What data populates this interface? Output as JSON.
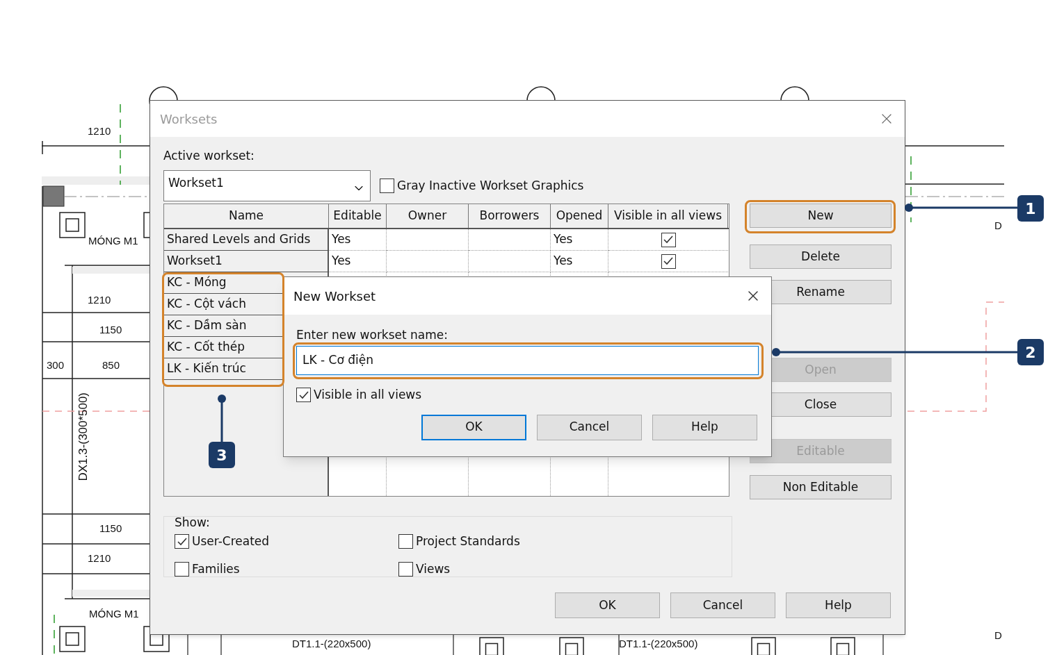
{
  "drawing": {
    "labels": [
      "1210",
      "MÓNG M1",
      "1210",
      "1150",
      "300",
      "850",
      "DX1.3-(300*500)",
      "1150",
      "1210",
      "MÓNG M1",
      "DT1.1-(220x500)",
      "DT1.1-(220x500)",
      "D",
      "D"
    ]
  },
  "dialog": {
    "title": "Worksets",
    "active_workset_label": "Active workset:",
    "active_workset": "Workset1",
    "gray_inactive": {
      "label": "Gray Inactive Workset Graphics",
      "checked": false
    },
    "table": {
      "columns": [
        "Name",
        "Editable",
        "Owner",
        "Borrowers",
        "Opened",
        "Visible in all views"
      ],
      "rows": [
        {
          "name": "Shared Levels and Grids",
          "editable": "Yes",
          "opened": "Yes",
          "visible": true
        },
        {
          "name": "Workset1",
          "editable": "Yes",
          "opened": "Yes",
          "visible": true
        },
        {
          "name": "KC - Móng"
        },
        {
          "name": "KC - Cột vách"
        },
        {
          "name": "KC - Dầm sàn"
        },
        {
          "name": "KC - Cốt thép"
        },
        {
          "name": "LK - Kiến trúc"
        }
      ]
    },
    "side_buttons": [
      {
        "label": "New",
        "disabled": false
      },
      {
        "label": "Delete",
        "disabled": false
      },
      {
        "label": "Rename",
        "disabled": false
      },
      {
        "label": "Open",
        "disabled": true
      },
      {
        "label": "Close",
        "disabled": false
      },
      {
        "label": "Editable",
        "disabled": true
      },
      {
        "label": "Non Editable",
        "disabled": false
      }
    ],
    "show": {
      "label": "Show:",
      "options": [
        {
          "label": "User-Created",
          "checked": true
        },
        {
          "label": "Project Standards",
          "checked": false
        },
        {
          "label": "Families",
          "checked": false
        },
        {
          "label": "Views",
          "checked": false
        }
      ]
    },
    "buttons": [
      "OK",
      "Cancel",
      "Help"
    ]
  },
  "new_workset": {
    "title": "New Workset",
    "prompt": "Enter new workset name:",
    "value": "LK - Cơ điện",
    "visible": {
      "label": "Visible in all views",
      "checked": true
    },
    "buttons": [
      {
        "label": "OK",
        "default": true
      },
      {
        "label": "Cancel",
        "default": false
      },
      {
        "label": "Help",
        "default": false
      }
    ]
  },
  "callouts": [
    "1",
    "2",
    "3"
  ]
}
